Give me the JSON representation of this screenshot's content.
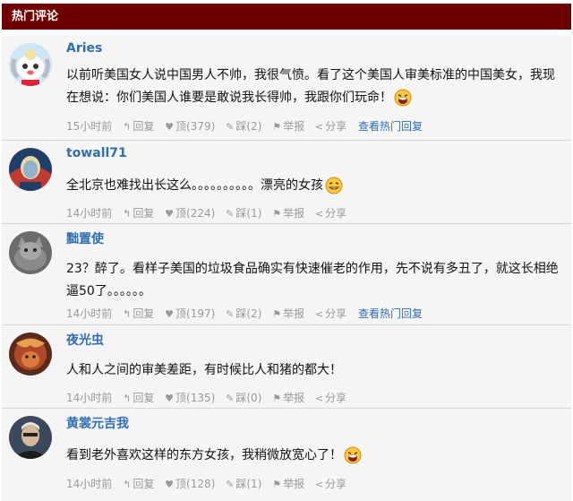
{
  "header": {
    "title": "热门评论"
  },
  "comments": [
    {
      "user": "Aries",
      "text": "以前听美国女人说中国男人不帅，我很气愤。看了这个美国人审美标准的中国美女，我现在想说：你们美国人谁要是敢说我长得帅，我跟你们玩命！",
      "time": "15小时前",
      "reply": "回复",
      "up": "顶(379)",
      "down": "踩(2)",
      "report": "举报",
      "share": "分享",
      "hot_reply": "查看热门回复"
    },
    {
      "user": "towall71",
      "text": "全北京也难找出长这么。。。。。。。。。。漂亮的女孩",
      "time": "14小时前",
      "reply": "回复",
      "up": "顶(224)",
      "down": "踩(1)",
      "report": "举报",
      "share": "分享"
    },
    {
      "user": "黜置使",
      "text": "23？醉了。看样子美国的垃圾食品确实有快速催老的作用，先不说有多丑了，就这长相绝逼50了。。。。。。",
      "time": "14小时前",
      "reply": "回复",
      "up": "顶(197)",
      "down": "踩(2)",
      "report": "举报",
      "share": "分享",
      "hot_reply": "查看热门回复"
    },
    {
      "user": "夜光虫",
      "text": "人和人之间的审美差距，有时候比人和猪的都大！",
      "time": "14小时前",
      "reply": "回复",
      "up": "顶(135)",
      "down": "踩(0)",
      "report": "举报",
      "share": "分享"
    },
    {
      "user": "黄裳元吉我",
      "text": "看到老外喜欢这样的东方女孩，我稍微放宽心了！",
      "time": "14小时前",
      "reply": "回复",
      "up": "顶(128)",
      "down": "踩(1)",
      "report": "举报",
      "share": "分享"
    }
  ],
  "icons": {
    "reply": "reply-arrow-icon",
    "up": "heart-icon",
    "down": "thumb-down-icon",
    "report": "flag-icon",
    "share": "share-icon",
    "emoji_laugh": "laughing-emoji-icon",
    "emoji_grin": "grinning-emoji-icon"
  },
  "colors": {
    "header_bg": "#6e0000",
    "username": "#2f6fb0",
    "meta": "#9a9a9a",
    "row_bg": "#f5f5f5"
  }
}
